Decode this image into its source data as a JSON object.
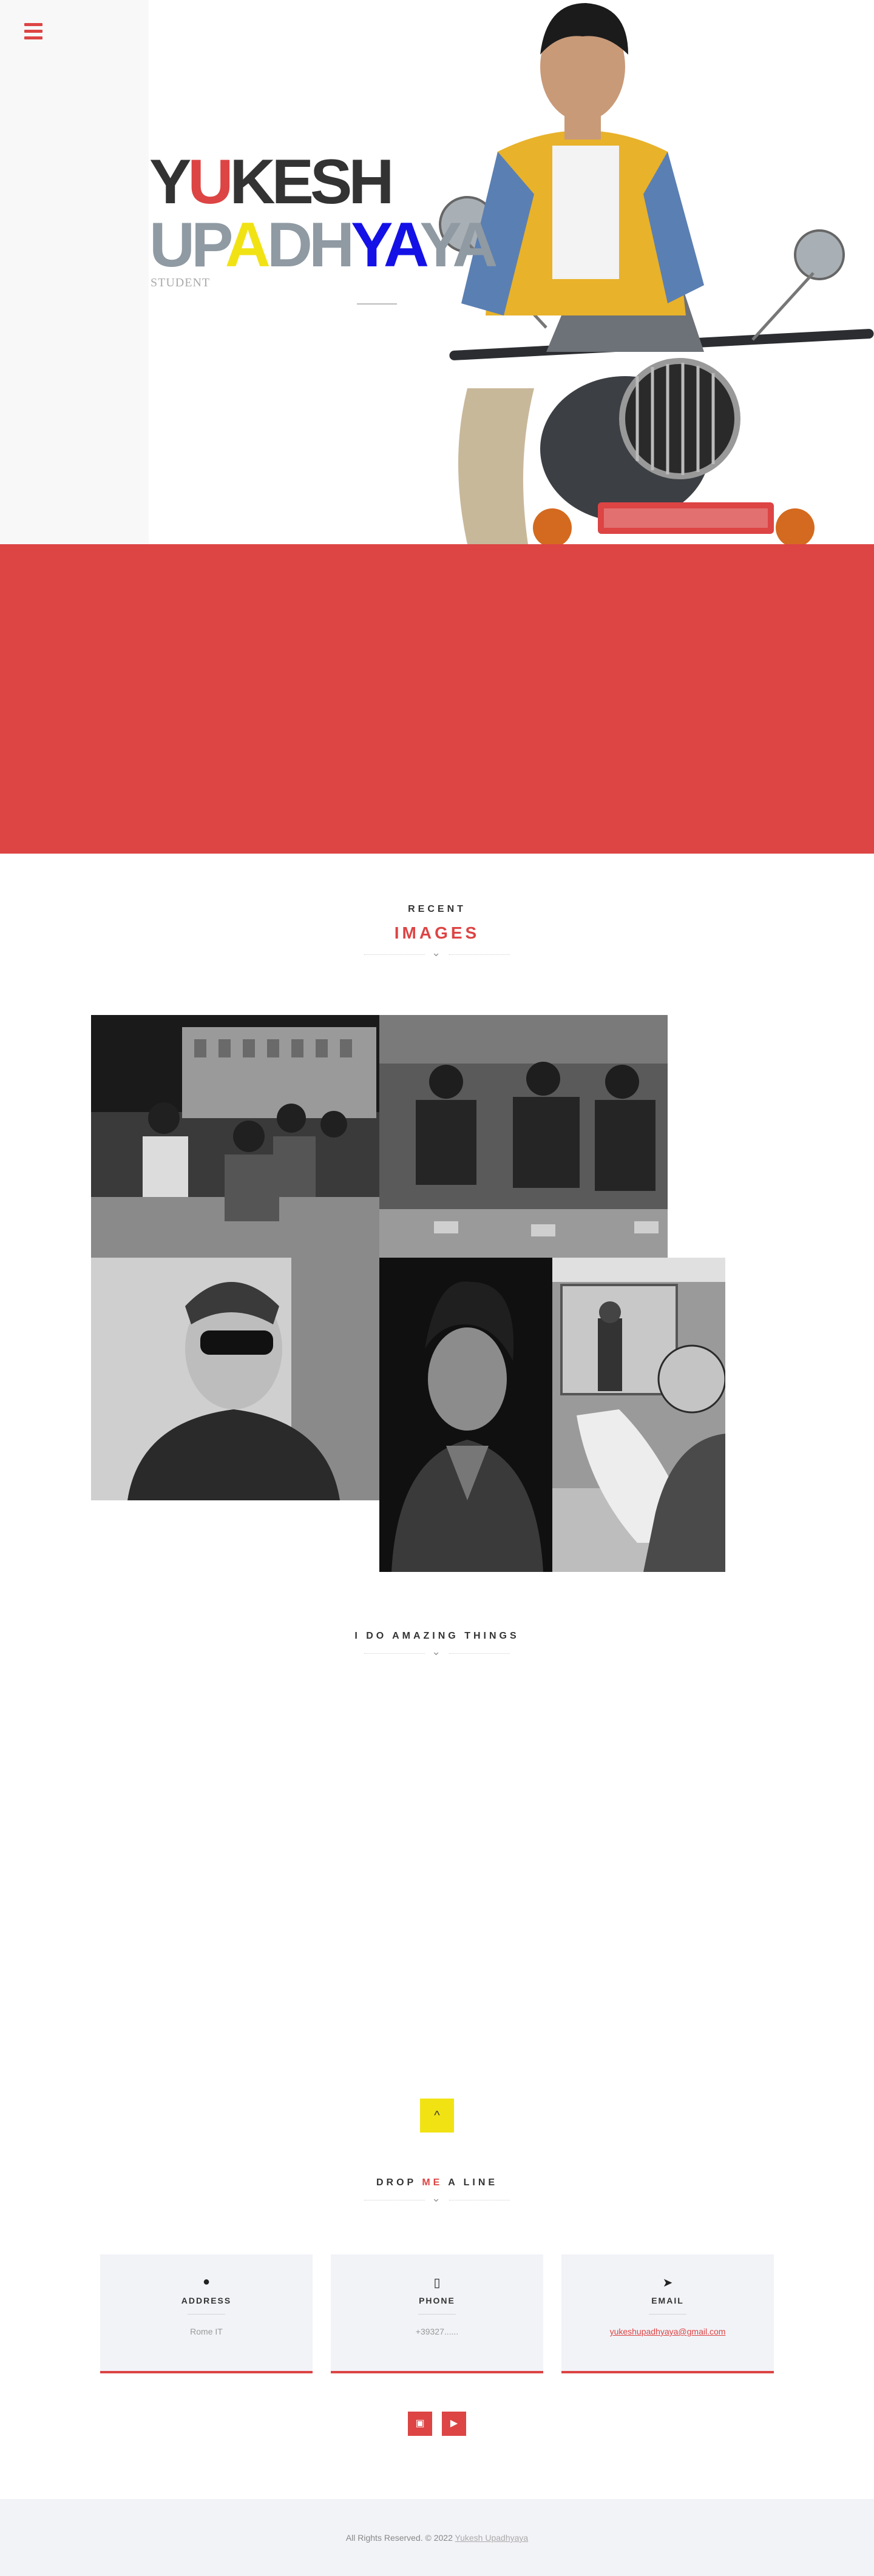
{
  "hero": {
    "first_name": [
      "Y",
      "U",
      "KESH"
    ],
    "last_name": [
      "UP",
      "A",
      "DH",
      "YA",
      "YA"
    ],
    "role": "STUDENT",
    "menu_icon": "hamburger-menu-icon"
  },
  "colors": {
    "accent_red": "#dd4444",
    "yellow": "#f1e214",
    "blue": "#1411e6",
    "grey": "#8f9aa3"
  },
  "recent": {
    "subtitle": "RECENT",
    "title": "IMAGES",
    "icon": "chevron-down-icon"
  },
  "gallery": {
    "images": [
      {
        "name": "gallery-image-1"
      },
      {
        "name": "gallery-image-2"
      },
      {
        "name": "gallery-image-3"
      },
      {
        "name": "gallery-image-4"
      },
      {
        "name": "gallery-image-5"
      }
    ]
  },
  "amazing": {
    "subtitle": "I DO AMAZING THINGS",
    "icon": "chevron-down-icon"
  },
  "scroll_top": {
    "icon": "chevron-up-icon",
    "label": "^"
  },
  "contact": {
    "title_parts": [
      "DROP ",
      "ME",
      " A LINE"
    ],
    "cards": [
      {
        "icon": "map-marker-icon",
        "glyph": "●",
        "title": "ADDRESS",
        "value": "Rome IT"
      },
      {
        "icon": "mobile-phone-icon",
        "glyph": "▯",
        "title": "PHONE",
        "value": "+39327......"
      },
      {
        "icon": "paper-plane-icon",
        "glyph": "➤",
        "title": "EMAIL",
        "value": "yukeshupadhyaya@gmail.com"
      }
    ]
  },
  "social": [
    {
      "icon": "instagram-icon",
      "glyph": "▣"
    },
    {
      "icon": "youtube-icon",
      "glyph": "▶"
    }
  ],
  "footer": {
    "text": "All Rights Reserved. © 2022",
    "link": "Yukesh Upadhyaya"
  }
}
